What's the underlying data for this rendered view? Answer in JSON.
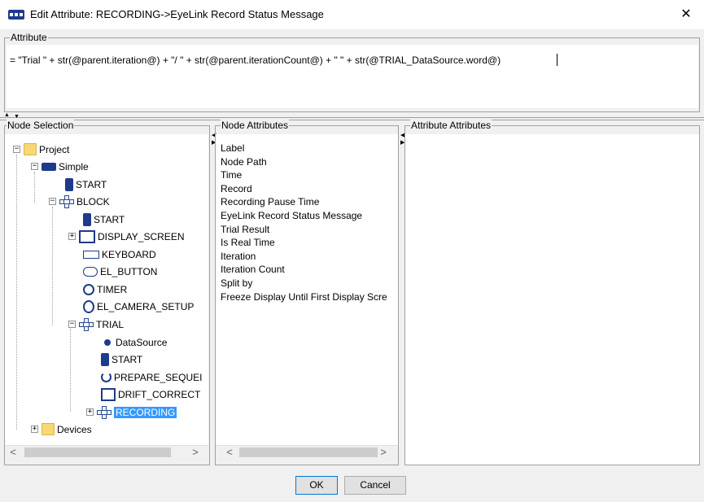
{
  "window": {
    "title": "Edit Attribute: RECORDING->EyeLink Record Status Message",
    "close_glyph": "✕",
    "app_icon": "sequence-icon"
  },
  "attribute_group": {
    "legend": "Attribute",
    "expression": "= \"Trial \" + str(@parent.iteration@) + \"/ \" + str(@parent.iterationCount@) + \" \" + str(@TRIAL_DataSource.word@)"
  },
  "node_selection": {
    "legend": "Node Selection",
    "tree": [
      {
        "label": "Project",
        "icon": "folder-icon",
        "expander": "⊟"
      },
      {
        "label": "Simple",
        "icon": "sequence-icon",
        "expander": "⊟"
      },
      {
        "label": "START",
        "icon": "traffic-light-icon"
      },
      {
        "label": "BLOCK",
        "icon": "block-icon",
        "expander": "⊟"
      },
      {
        "label": "START",
        "icon": "traffic-light-icon"
      },
      {
        "label": "DISPLAY_SCREEN",
        "icon": "display-screen-icon",
        "expander": "⊞"
      },
      {
        "label": "KEYBOARD",
        "icon": "keyboard-icon"
      },
      {
        "label": "EL_BUTTON",
        "icon": "gamepad-icon"
      },
      {
        "label": "TIMER",
        "icon": "timer-icon"
      },
      {
        "label": "EL_CAMERA_SETUP",
        "icon": "eye-icon"
      },
      {
        "label": "TRIAL",
        "icon": "block-icon",
        "expander": "⊟"
      },
      {
        "label": "DataSource",
        "icon": "dot-icon"
      },
      {
        "label": "START",
        "icon": "traffic-light-icon"
      },
      {
        "label": "PREPARE_SEQUEI",
        "icon": "refresh-icon"
      },
      {
        "label": "DRIFT_CORRECT",
        "icon": "drift-correct-icon"
      },
      {
        "label": "RECORDING",
        "icon": "block-icon",
        "expander": "⊞",
        "selected": true
      },
      {
        "label": "Devices",
        "icon": "folder-icon",
        "expander": "⊞"
      }
    ]
  },
  "node_attributes": {
    "legend": "Node Attributes",
    "items": [
      "Label",
      "Node Path",
      "Time",
      "Record",
      "Recording Pause Time",
      "EyeLink Record Status Message",
      "Trial Result",
      "Is Real Time",
      "Iteration",
      "Iteration Count",
      "Split by",
      "Freeze Display Until First Display Scre"
    ]
  },
  "attribute_attributes": {
    "legend": "Attribute Attributes"
  },
  "scroll": {
    "left_arrow": "<",
    "right_arrow": ">"
  },
  "buttons": {
    "ok": "OK",
    "cancel": "Cancel"
  }
}
